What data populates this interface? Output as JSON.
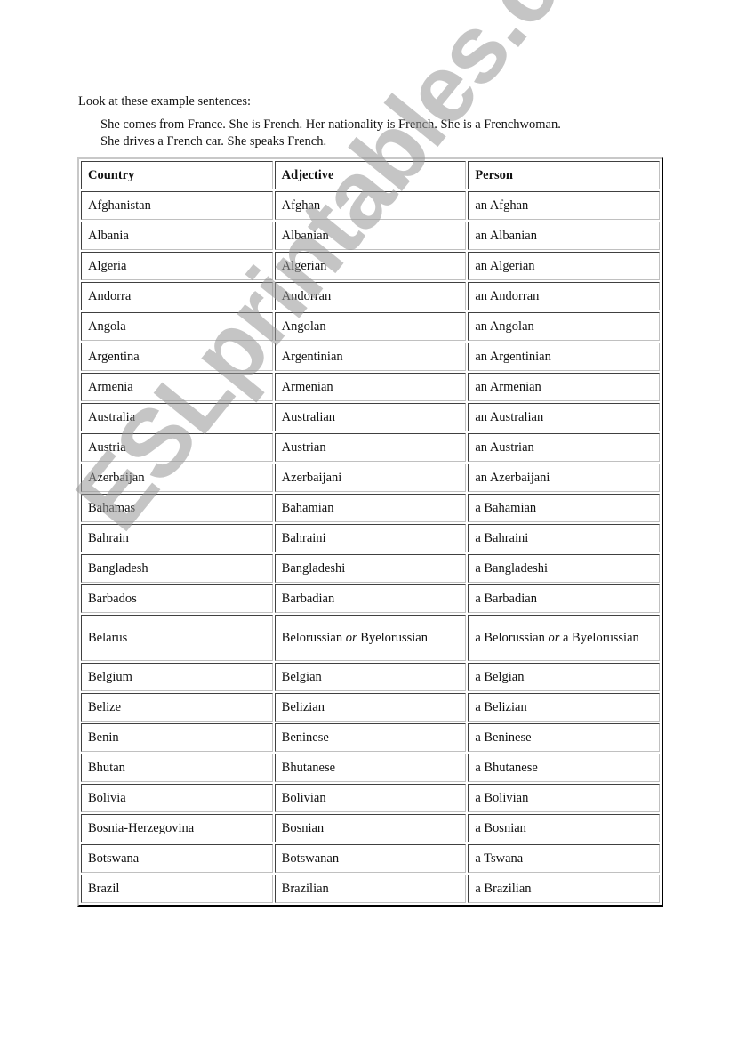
{
  "intro": "Look at these example sentences:",
  "examples": [
    "She comes from France. She is French. Her nationality is French. She is a Frenchwoman.",
    "She drives a French car. She speaks French."
  ],
  "table": {
    "headers": [
      "Country",
      "Adjective",
      "Person"
    ],
    "rows": [
      [
        "Afghanistan",
        "Afghan",
        "an Afghan"
      ],
      [
        "Albania",
        "Albanian",
        "an Albanian"
      ],
      [
        "Algeria",
        "Algerian",
        "an Algerian"
      ],
      [
        "Andorra",
        "Andorran",
        "an Andorran"
      ],
      [
        "Angola",
        "Angolan",
        "an Angolan"
      ],
      [
        "Argentina",
        "Argentinian",
        "an Argentinian"
      ],
      [
        "Armenia",
        "Armenian",
        "an Armenian"
      ],
      [
        "Australia",
        "Australian",
        "an Australian"
      ],
      [
        "Austria",
        "Austrian",
        "an Austrian"
      ],
      [
        "Azerbaijan",
        "Azerbaijani",
        "an Azerbaijani"
      ],
      [
        "Bahamas",
        "Bahamian",
        "a Bahamian"
      ],
      [
        "Bahrain",
        "Bahraini",
        "a Bahraini"
      ],
      [
        "Bangladesh",
        "Bangladeshi",
        "a Bangladeshi"
      ],
      [
        "Barbados",
        "Barbadian",
        "a Barbadian"
      ],
      [
        "Belarus",
        "Belorussian or Byelorussian",
        "a Belorussian or a Byelorussian"
      ],
      [
        "Belgium",
        "Belgian",
        "a Belgian"
      ],
      [
        "Belize",
        "Belizian",
        "a Belizian"
      ],
      [
        "Benin",
        "Beninese",
        "a Beninese"
      ],
      [
        "Bhutan",
        "Bhutanese",
        "a Bhutanese"
      ],
      [
        "Bolivia",
        "Bolivian",
        "a Bolivian"
      ],
      [
        "Bosnia-Herzegovina",
        "Bosnian",
        "a Bosnian"
      ],
      [
        "Botswana",
        "Botswanan",
        "a Tswana"
      ],
      [
        "Brazil",
        "Brazilian",
        "a Brazilian"
      ]
    ],
    "belarus_parts": {
      "adj_a": "Belorussian ",
      "or": "or",
      "adj_b": " Byelorussian",
      "person_a": "a Belorussian ",
      "person_b": " a Byelorussian"
    }
  },
  "watermark": "ESLprintables.com"
}
